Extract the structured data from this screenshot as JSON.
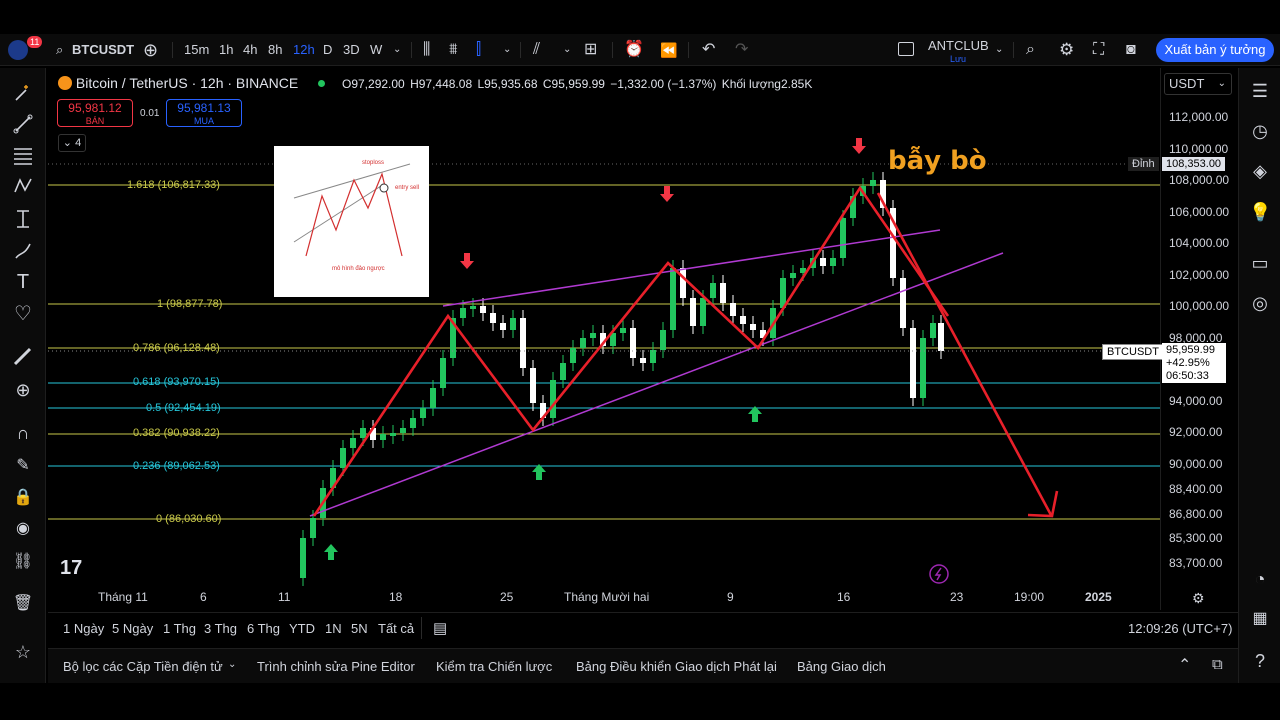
{
  "toolbar": {
    "notification_count": "11",
    "symbol": "BTCUSDT",
    "timeframes": [
      "15m",
      "1h",
      "4h",
      "8h",
      "12h",
      "D",
      "3D",
      "W"
    ],
    "active_timeframe": "12h",
    "account_name": "ANTCLUB",
    "account_status": "Lưu",
    "publish_label": "Xuất bản ý tưởng"
  },
  "legend": {
    "title": "Bitcoin / TetherUS · 12h · BINANCE",
    "open": "O97,292.00",
    "high": "H97,448.08",
    "low": "L95,935.68",
    "close": "C95,959.99",
    "change": "−1,332.00 (−1.37%)",
    "volume": "Khối lượng2.85K"
  },
  "quote": {
    "sell_price": "95,981.12",
    "sell_label": "BÁN",
    "spread": "0.01",
    "buy_price": "95,981.13",
    "buy_label": "MUA",
    "collapse_count": "4"
  },
  "currency": "USDT",
  "price_axis": [
    "112,000.00",
    "110,000.00",
    "108,000.00",
    "106,000.00",
    "104,000.00",
    "102,000.00",
    "100,000.00",
    "98,000.00",
    "96,000.00",
    "94,000.00",
    "92,000.00",
    "90,000.00",
    "88,400.00",
    "86,800.00",
    "85,300.00",
    "83,700.00"
  ],
  "peak_label": "Đỉnh",
  "peak_price": "108,353.00",
  "symbol_tag": "BTCUSDT",
  "last_price": "95,959.99",
  "last_change": "+42.95%",
  "countdown": "06:50:33",
  "fib_levels": [
    {
      "label": "1.618 (106,817.33)",
      "color": "#c9c94a"
    },
    {
      "label": "1 (98,877.78)",
      "color": "#c9c94a"
    },
    {
      "label": "0.786 (96,128.48)",
      "color": "#c9c94a"
    },
    {
      "label": "0.618 (93,970.15)",
      "color": "#26c6da"
    },
    {
      "label": "0.5 (92,454.19)",
      "color": "#26c6da"
    },
    {
      "label": "0.382 (90,938.22)",
      "color": "#c9c94a"
    },
    {
      "label": "0.236 (89,062.53)",
      "color": "#26c6da"
    },
    {
      "label": "0 (86,030.60)",
      "color": "#c9c94a"
    }
  ],
  "annotation_text": "bẫy bò",
  "inset": {
    "stoploss": "stoploss",
    "entry": "entry sell",
    "caption": "mô hình đảo ngược"
  },
  "time_axis": [
    "Tháng 11",
    "6",
    "11",
    "18",
    "25",
    "Tháng Mười hai",
    "9",
    "16",
    "23",
    "19:00",
    "2025"
  ],
  "ranges": [
    "1 Ngày",
    "5 Ngày",
    "1 Thg",
    "3 Thg",
    "6 Thg",
    "YTD",
    "1N",
    "5N",
    "Tất cả"
  ],
  "clock": "12:09:26 (UTC+7)",
  "bottom_tabs": [
    "Bộ lọc các Cặp Tiền điện tử",
    "Trình chỉnh sửa Pine Editor",
    "Kiểm tra Chiến lược",
    "Bảng Điều khiển Giao dịch Phát lại",
    "Bảng Giao dịch"
  ],
  "colors": {
    "up": "#22c55e",
    "down": "#ffffff",
    "accent": "#2962ff",
    "pattern_line": "#e8202a",
    "channel": "#b03ad1",
    "annotation": "#f0a020"
  }
}
